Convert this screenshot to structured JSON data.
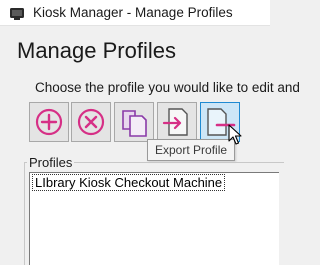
{
  "window": {
    "title": "Kiosk Manager - Manage Profiles",
    "icon": "kiosk-app-icon"
  },
  "page": {
    "title": "Manage Profiles",
    "instruction": "Choose the profile you would like to edit and"
  },
  "toolbar": {
    "buttons": [
      {
        "name": "add-profile",
        "icon": "plus-circle-icon"
      },
      {
        "name": "delete-profile",
        "icon": "x-circle-icon"
      },
      {
        "name": "duplicate-profile",
        "icon": "copy-icon"
      },
      {
        "name": "import-profile",
        "icon": "import-arrow-icon"
      },
      {
        "name": "export-profile",
        "icon": "export-arrow-icon",
        "state": "hover"
      }
    ],
    "tooltip": "Export Profile"
  },
  "profiles": {
    "label": "Profiles",
    "items": [
      "LIbrary Kiosk Checkout Machine"
    ],
    "selected_index": 0
  },
  "colors": {
    "accent": "#d62f86",
    "hover_border": "#1f8ad2",
    "hover_fill": "#cde6f7"
  }
}
